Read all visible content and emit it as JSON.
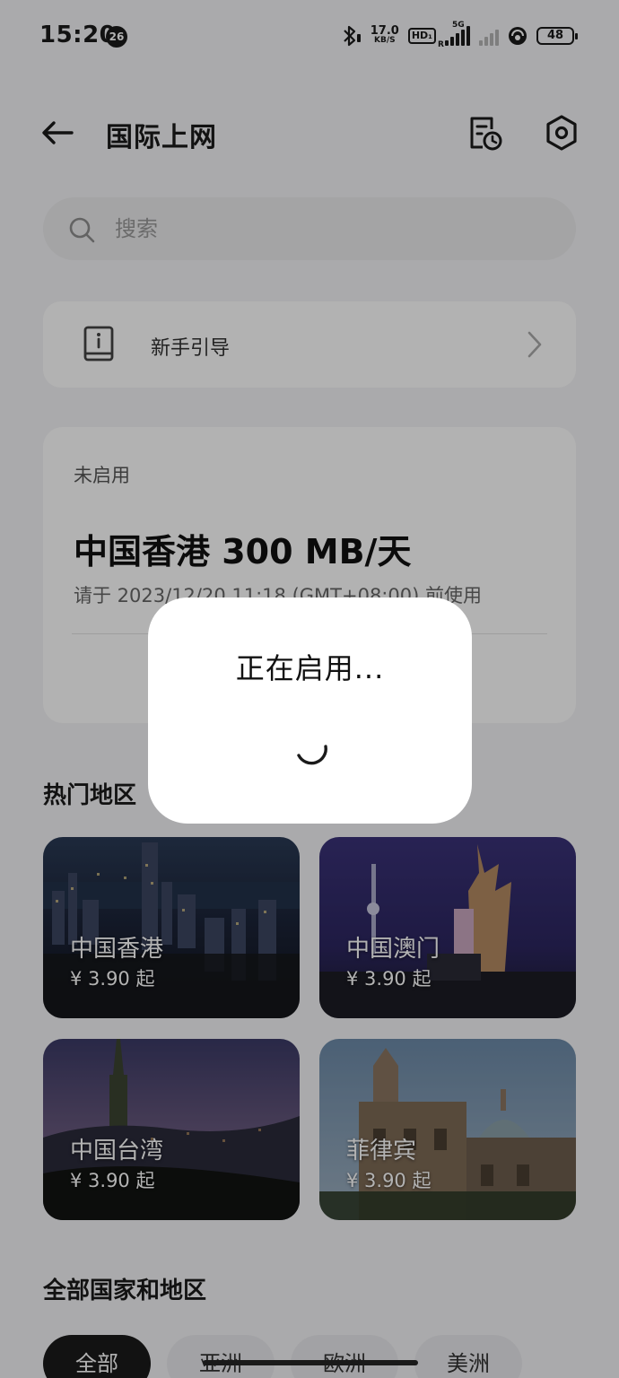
{
  "status_bar": {
    "time": "15:20",
    "notification_count": "26",
    "net_speed_value": "17.0",
    "net_speed_unit": "KB/S",
    "hd_label": "HD₁",
    "sim1_tag": "5G",
    "sim1_sub": "R",
    "battery": "48"
  },
  "header": {
    "title": "国际上网"
  },
  "search": {
    "placeholder": "搜索"
  },
  "guide": {
    "label": "新手引导"
  },
  "plan": {
    "state": "未启用",
    "name": "中国香港 300 MB/天",
    "desc": "请于 2023/12/20 11:18 (GMT+08:00) 前使用"
  },
  "popular": {
    "title": "热门地区",
    "cards": [
      {
        "name": "中国香港",
        "price": "¥ 3.90 起"
      },
      {
        "name": "中国澳门",
        "price": "¥ 3.90 起"
      },
      {
        "name": "中国台湾",
        "price": "¥ 3.90 起"
      },
      {
        "name": "菲律宾",
        "price": "¥ 3.90 起"
      }
    ]
  },
  "all_regions": {
    "title": "全部国家和地区",
    "chips": [
      "全部",
      "亚洲",
      "欧洲",
      "美洲"
    ]
  },
  "dialog": {
    "text": "正在启用..."
  }
}
